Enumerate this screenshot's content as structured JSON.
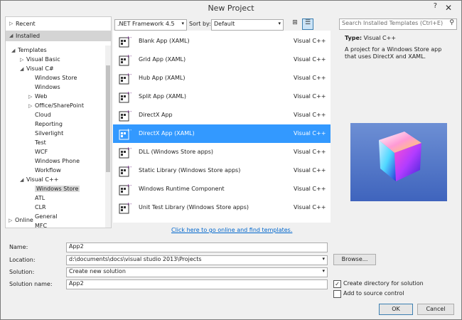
{
  "window": {
    "title": "New Project",
    "help": "?",
    "close": "✕"
  },
  "left": {
    "recent": "Recent",
    "installed": "Installed",
    "online": "Online",
    "tree": [
      {
        "label": "Templates",
        "arrow": "◢",
        "indent": 0
      },
      {
        "label": "Visual Basic",
        "arrow": "▷",
        "indent": 1
      },
      {
        "label": "Visual C#",
        "arrow": "◢",
        "indent": 1
      },
      {
        "label": "Windows Store",
        "arrow": "",
        "indent": 2
      },
      {
        "label": "Windows",
        "arrow": "",
        "indent": 2
      },
      {
        "label": "Web",
        "arrow": "▷",
        "indent": 2
      },
      {
        "label": "Office/SharePoint",
        "arrow": "▷",
        "indent": 2
      },
      {
        "label": "Cloud",
        "arrow": "",
        "indent": 2
      },
      {
        "label": "Reporting",
        "arrow": "",
        "indent": 2
      },
      {
        "label": "Silverlight",
        "arrow": "",
        "indent": 2
      },
      {
        "label": "Test",
        "arrow": "",
        "indent": 2
      },
      {
        "label": "WCF",
        "arrow": "",
        "indent": 2
      },
      {
        "label": "Windows Phone",
        "arrow": "",
        "indent": 2
      },
      {
        "label": "Workflow",
        "arrow": "",
        "indent": 2
      },
      {
        "label": "Visual C++",
        "arrow": "◢",
        "indent": 1
      },
      {
        "label": "Windows Store",
        "arrow": "",
        "indent": 2
      },
      {
        "label": "ATL",
        "arrow": "",
        "indent": 2
      },
      {
        "label": "CLR",
        "arrow": "",
        "indent": 2
      },
      {
        "label": "General",
        "arrow": "",
        "indent": 2
      },
      {
        "label": "MFC",
        "arrow": "",
        "indent": 2
      }
    ]
  },
  "toolbar": {
    "framework": ".NET Framework 4.5",
    "sort_label": "Sort by:",
    "sort_value": "Default",
    "search_placeholder": "Search Installed Templates (Ctrl+E)"
  },
  "templates": [
    {
      "name": "Blank App (XAML)",
      "lang": "Visual C++"
    },
    {
      "name": "Grid App (XAML)",
      "lang": "Visual C++"
    },
    {
      "name": "Hub App (XAML)",
      "lang": "Visual C++"
    },
    {
      "name": "Split App (XAML)",
      "lang": "Visual C++"
    },
    {
      "name": "DirectX App",
      "lang": "Visual C++"
    },
    {
      "name": "DirectX App (XAML)",
      "lang": "Visual C++"
    },
    {
      "name": "DLL (Windows Store apps)",
      "lang": "Visual C++"
    },
    {
      "name": "Static Library (Windows Store apps)",
      "lang": "Visual C++"
    },
    {
      "name": "Windows Runtime Component",
      "lang": "Visual C++"
    },
    {
      "name": "Unit Test Library (Windows Store apps)",
      "lang": "Visual C++"
    }
  ],
  "online_link": "Click here to go online and find templates.",
  "details": {
    "type_label": "Type:",
    "type_value": "Visual C++",
    "description": "A project for a Windows Store app that uses DirectX and XAML."
  },
  "form": {
    "name_label": "Name:",
    "name_value": "App2",
    "location_label": "Location:",
    "location_value": "d:\\documents\\docs\\visual studio 2013\\Projects",
    "solution_label": "Solution:",
    "solution_value": "Create new solution",
    "solution_name_label": "Solution name:",
    "solution_name_value": "App2",
    "browse": "Browse...",
    "create_dir": "Create directory for solution",
    "add_source": "Add to source control",
    "ok": "OK",
    "cancel": "Cancel"
  },
  "colors": {
    "selection": "#3399ff",
    "link": "#0066cc",
    "icon_purple": "#68217a"
  }
}
